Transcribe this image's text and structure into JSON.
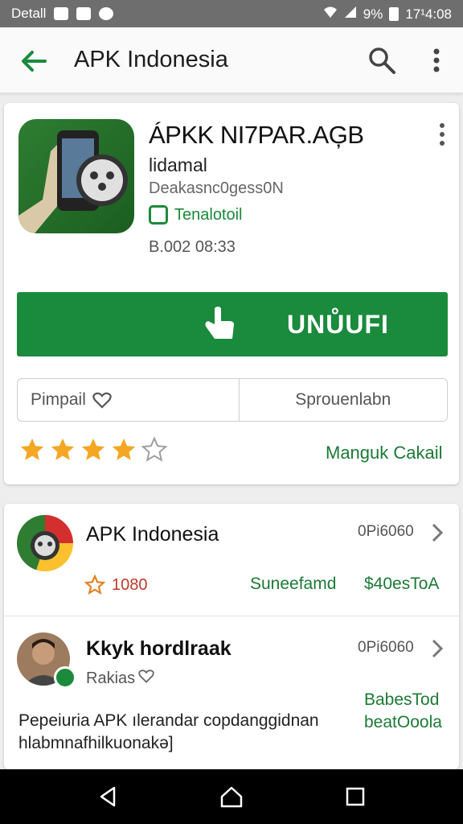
{
  "status_bar": {
    "carrier": "Detall",
    "battery": "9%",
    "time": "17¹4:08"
  },
  "app_bar": {
    "title": "APK Indonesia"
  },
  "app_card": {
    "name": "ÁPKK NI7PAR.AĢB",
    "developer": "lidamal",
    "category": "Deakasnc0gess0N",
    "badge": "Tenalotoil",
    "size_date": "B.002 08:33",
    "install_label": "UNŮUFI",
    "wishlist_label": "Pimpail",
    "secondary_label": "Sprouenlabn",
    "rating": 4,
    "rating_max": 5,
    "review_link": "Manguk Cakail"
  },
  "list": [
    {
      "title": "APK Indonesia",
      "meta": "0Pi6060",
      "rating_count": "1080",
      "status_a": "Suneefamd",
      "status_b": "$40esToA"
    },
    {
      "title": "Kkyk hordlraak",
      "meta": "0Pi6060",
      "sub_label": "Rakias",
      "green_note": "BabesTod beatOoola",
      "description": "Pepeiuria APK ılerandar copdanggidnan hlabmnafhilkuonakə]"
    }
  ],
  "colors": {
    "accent": "#1a8a3c",
    "star": "#f5a623",
    "status_bar": "#6e6e6e"
  }
}
